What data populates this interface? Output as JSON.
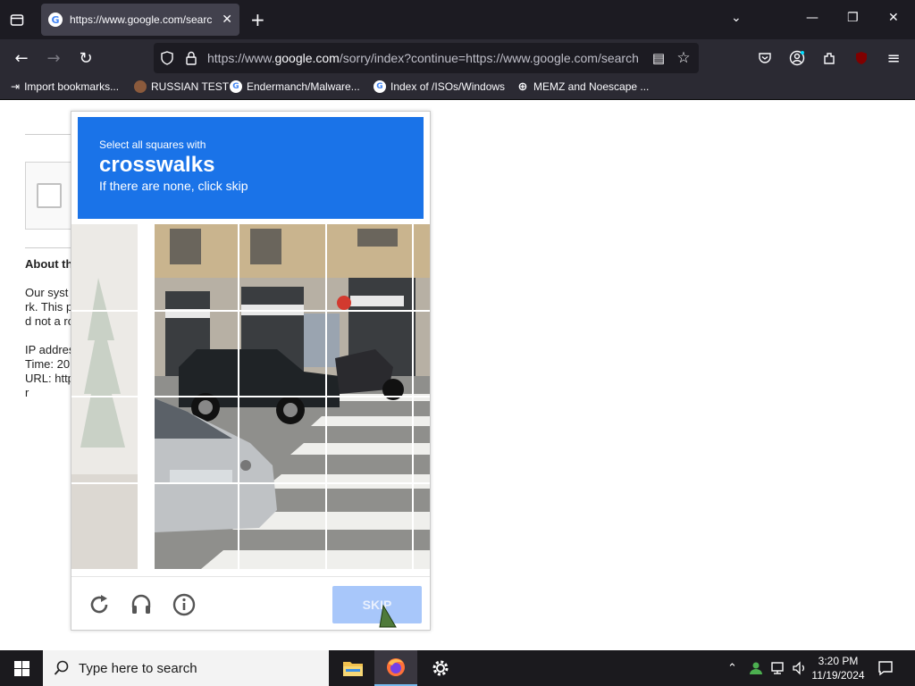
{
  "browser": {
    "tab": {
      "title": "https://www.google.com/searc",
      "favicon": "G"
    },
    "url": {
      "prefix": "https://www.",
      "domain": "google.com",
      "rest": "/sorry/index?continue=https://www.google.com/search"
    },
    "bookmarks": [
      {
        "label": "Import bookmarks...",
        "icon": "import-icon"
      },
      {
        "label": "RUSSIAN TEST",
        "icon": "site-icon"
      },
      {
        "label": "Endermanch/Malware...",
        "icon": "google-icon"
      },
      {
        "label": "Index of /ISOs/Windows",
        "icon": "google-icon"
      },
      {
        "label": "MEMZ and Noescape ...",
        "icon": "globe-icon"
      }
    ]
  },
  "page": {
    "about_heading": "About th",
    "lines": [
      "Our syst",
      "rk. This p",
      "d not a ro",
      "",
      "IP addres",
      "Time: 20",
      "URL: http",
      "r"
    ]
  },
  "captcha": {
    "instruction": "Select all squares with",
    "target": "crosswalks",
    "hint": "If there are none, click skip",
    "skip_label": "SKIP",
    "header_color": "#1a73e8"
  },
  "taskbar": {
    "search_placeholder": "Type here to search",
    "time": "3:20 PM",
    "date": "11/19/2024"
  }
}
